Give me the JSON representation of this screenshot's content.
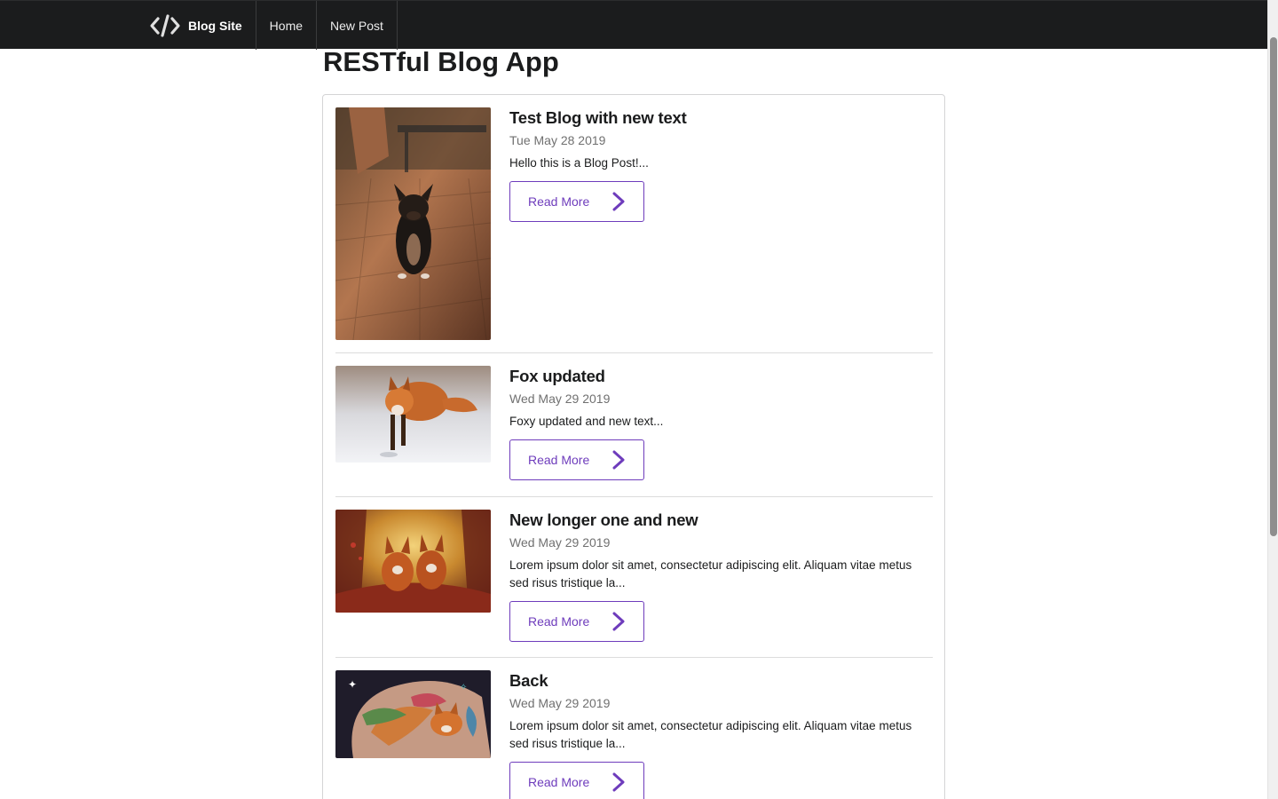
{
  "nav": {
    "brand": "Blog Site",
    "items": [
      "Home",
      "New Post"
    ]
  },
  "page": {
    "title": "RESTful Blog App"
  },
  "posts": [
    {
      "title": "Test Blog with new text",
      "date": "Tue May 28 2019",
      "excerpt": "Hello this is a Blog Post!...",
      "button": "Read More",
      "image": "french-bulldog-photo"
    },
    {
      "title": "Fox updated",
      "date": "Wed May 29 2019",
      "excerpt": "Foxy updated and new text...",
      "button": "Read More",
      "image": "fox-in-snow-photo"
    },
    {
      "title": "New longer one and new",
      "date": "Wed May 29 2019",
      "excerpt": "Lorem ipsum dolor sit amet, consectetur adipiscing elit. Aliquam vitae metus sed risus tristique la...",
      "button": "Read More",
      "image": "two-foxes-painting"
    },
    {
      "title": "Back",
      "date": "Wed May 29 2019",
      "excerpt": "Lorem ipsum dolor sit amet, consectetur adipiscing elit. Aliquam vitae metus sed risus tristique la...",
      "button": "Read More",
      "image": "fox-tattoo-photo"
    }
  ],
  "colors": {
    "navbar": "#1b1c1d",
    "accent": "#6e3cbc",
    "date": "#707070"
  }
}
